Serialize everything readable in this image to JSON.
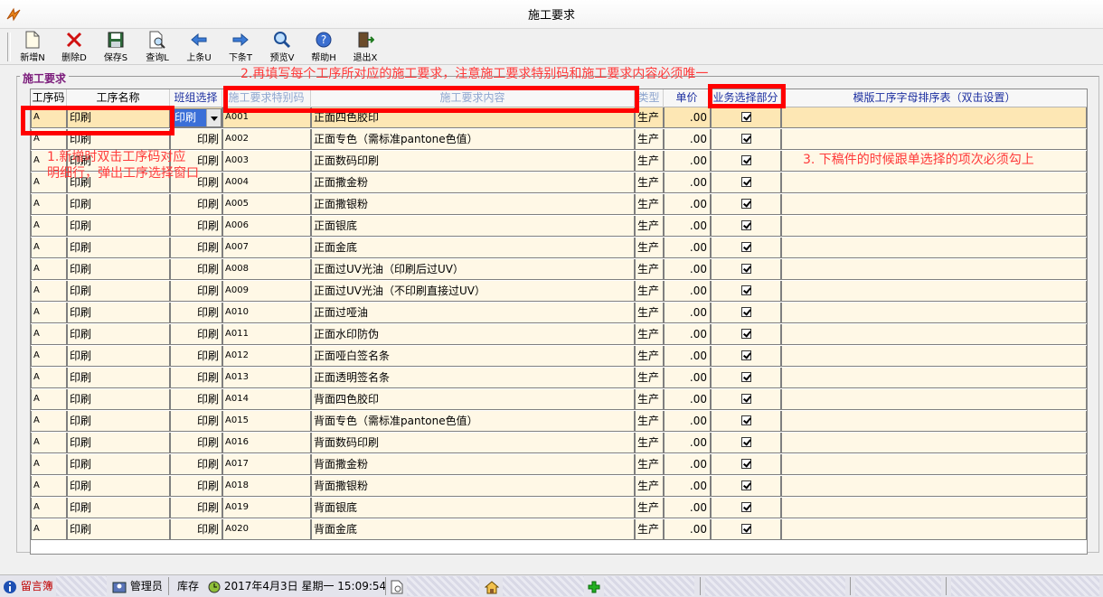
{
  "window": {
    "title": "施工要求"
  },
  "toolbar": {
    "buttons": [
      {
        "label": "新增N",
        "icon": "new-document-icon"
      },
      {
        "label": "删除D",
        "icon": "delete-x-icon"
      },
      {
        "label": "保存S",
        "icon": "save-disk-icon"
      },
      {
        "label": "查询L",
        "icon": "query-magnifier-doc-icon"
      },
      {
        "label": "上条U",
        "icon": "arrow-left-icon"
      },
      {
        "label": "下条T",
        "icon": "arrow-right-icon"
      },
      {
        "label": "预览V",
        "icon": "preview-magnifier-icon"
      },
      {
        "label": "帮助H",
        "icon": "help-icon"
      },
      {
        "label": "退出X",
        "icon": "exit-door-icon"
      }
    ]
  },
  "group": {
    "title": "施工要求"
  },
  "grid": {
    "headers": [
      "工序码",
      "工序名称",
      "班组选择",
      "施工要求特别码",
      "施工要求内容",
      "类型",
      "单价",
      "业务选择部分",
      "模版工序字母排序表（双击设置）"
    ],
    "rows": [
      {
        "code": "A",
        "name": "印刷",
        "team": "印刷",
        "special": "A001",
        "content": "正面四色胶印",
        "type": "生产",
        "price": ".00",
        "checked": true
      },
      {
        "code": "A",
        "name": "印刷",
        "team": "印刷",
        "special": "A002",
        "content": "正面专色（需标准pantone色值）",
        "type": "生产",
        "price": ".00",
        "checked": true
      },
      {
        "code": "A",
        "name": "印刷",
        "team": "印刷",
        "special": "A003",
        "content": "正面数码印刷",
        "type": "生产",
        "price": ".00",
        "checked": true
      },
      {
        "code": "A",
        "name": "印刷",
        "team": "印刷",
        "special": "A004",
        "content": "正面撒金粉",
        "type": "生产",
        "price": ".00",
        "checked": true
      },
      {
        "code": "A",
        "name": "印刷",
        "team": "印刷",
        "special": "A005",
        "content": "正面撒银粉",
        "type": "生产",
        "price": ".00",
        "checked": true
      },
      {
        "code": "A",
        "name": "印刷",
        "team": "印刷",
        "special": "A006",
        "content": "正面银底",
        "type": "生产",
        "price": ".00",
        "checked": true
      },
      {
        "code": "A",
        "name": "印刷",
        "team": "印刷",
        "special": "A007",
        "content": "正面金底",
        "type": "生产",
        "price": ".00",
        "checked": true
      },
      {
        "code": "A",
        "name": "印刷",
        "team": "印刷",
        "special": "A008",
        "content": "正面过UV光油（印刷后过UV）",
        "type": "生产",
        "price": ".00",
        "checked": true
      },
      {
        "code": "A",
        "name": "印刷",
        "team": "印刷",
        "special": "A009",
        "content": "正面过UV光油（不印刷直接过UV）",
        "type": "生产",
        "price": ".00",
        "checked": true
      },
      {
        "code": "A",
        "name": "印刷",
        "team": "印刷",
        "special": "A010",
        "content": "正面过哑油",
        "type": "生产",
        "price": ".00",
        "checked": true
      },
      {
        "code": "A",
        "name": "印刷",
        "team": "印刷",
        "special": "A011",
        "content": "正面水印防伪",
        "type": "生产",
        "price": ".00",
        "checked": true
      },
      {
        "code": "A",
        "name": "印刷",
        "team": "印刷",
        "special": "A012",
        "content": "正面哑白签名条",
        "type": "生产",
        "price": ".00",
        "checked": true
      },
      {
        "code": "A",
        "name": "印刷",
        "team": "印刷",
        "special": "A013",
        "content": "正面透明签名条",
        "type": "生产",
        "price": ".00",
        "checked": true
      },
      {
        "code": "A",
        "name": "印刷",
        "team": "印刷",
        "special": "A014",
        "content": "背面四色胶印",
        "type": "生产",
        "price": ".00",
        "checked": true
      },
      {
        "code": "A",
        "name": "印刷",
        "team": "印刷",
        "special": "A015",
        "content": "背面专色（需标准pantone色值）",
        "type": "生产",
        "price": ".00",
        "checked": true
      },
      {
        "code": "A",
        "name": "印刷",
        "team": "印刷",
        "special": "A016",
        "content": "背面数码印刷",
        "type": "生产",
        "price": ".00",
        "checked": true
      },
      {
        "code": "A",
        "name": "印刷",
        "team": "印刷",
        "special": "A017",
        "content": "背面撒金粉",
        "type": "生产",
        "price": ".00",
        "checked": true
      },
      {
        "code": "A",
        "name": "印刷",
        "team": "印刷",
        "special": "A018",
        "content": "背面撒银粉",
        "type": "生产",
        "price": ".00",
        "checked": true
      },
      {
        "code": "A",
        "name": "印刷",
        "team": "印刷",
        "special": "A019",
        "content": "背面银底",
        "type": "生产",
        "price": ".00",
        "checked": true
      },
      {
        "code": "A",
        "name": "印刷",
        "team": "印刷",
        "special": "A020",
        "content": "背面金底",
        "type": "生产",
        "price": ".00",
        "checked": true
      }
    ]
  },
  "annotations": {
    "note1_line1": "1.新增时双击工序码对应",
    "note1_line2": "明细行，弹出工序选择窗口",
    "note2": "2.再填写每个工序所对应的施工要求，注意施工要求特别码和施工要求内容必须唯一",
    "note3": "3. 下稿件的时候跟单选择的项次必须勾上",
    "color": "#ff0000"
  },
  "statusbar": {
    "guestbook": "留言簿",
    "user": "管理员",
    "module": "库存",
    "datetime": "2017年4月3日  星期一 15:09:54"
  },
  "colors": {
    "row_bg": "#fff8e6",
    "row_selected_bg": "#fde7b4",
    "header_blue": "#1c2fa0"
  }
}
